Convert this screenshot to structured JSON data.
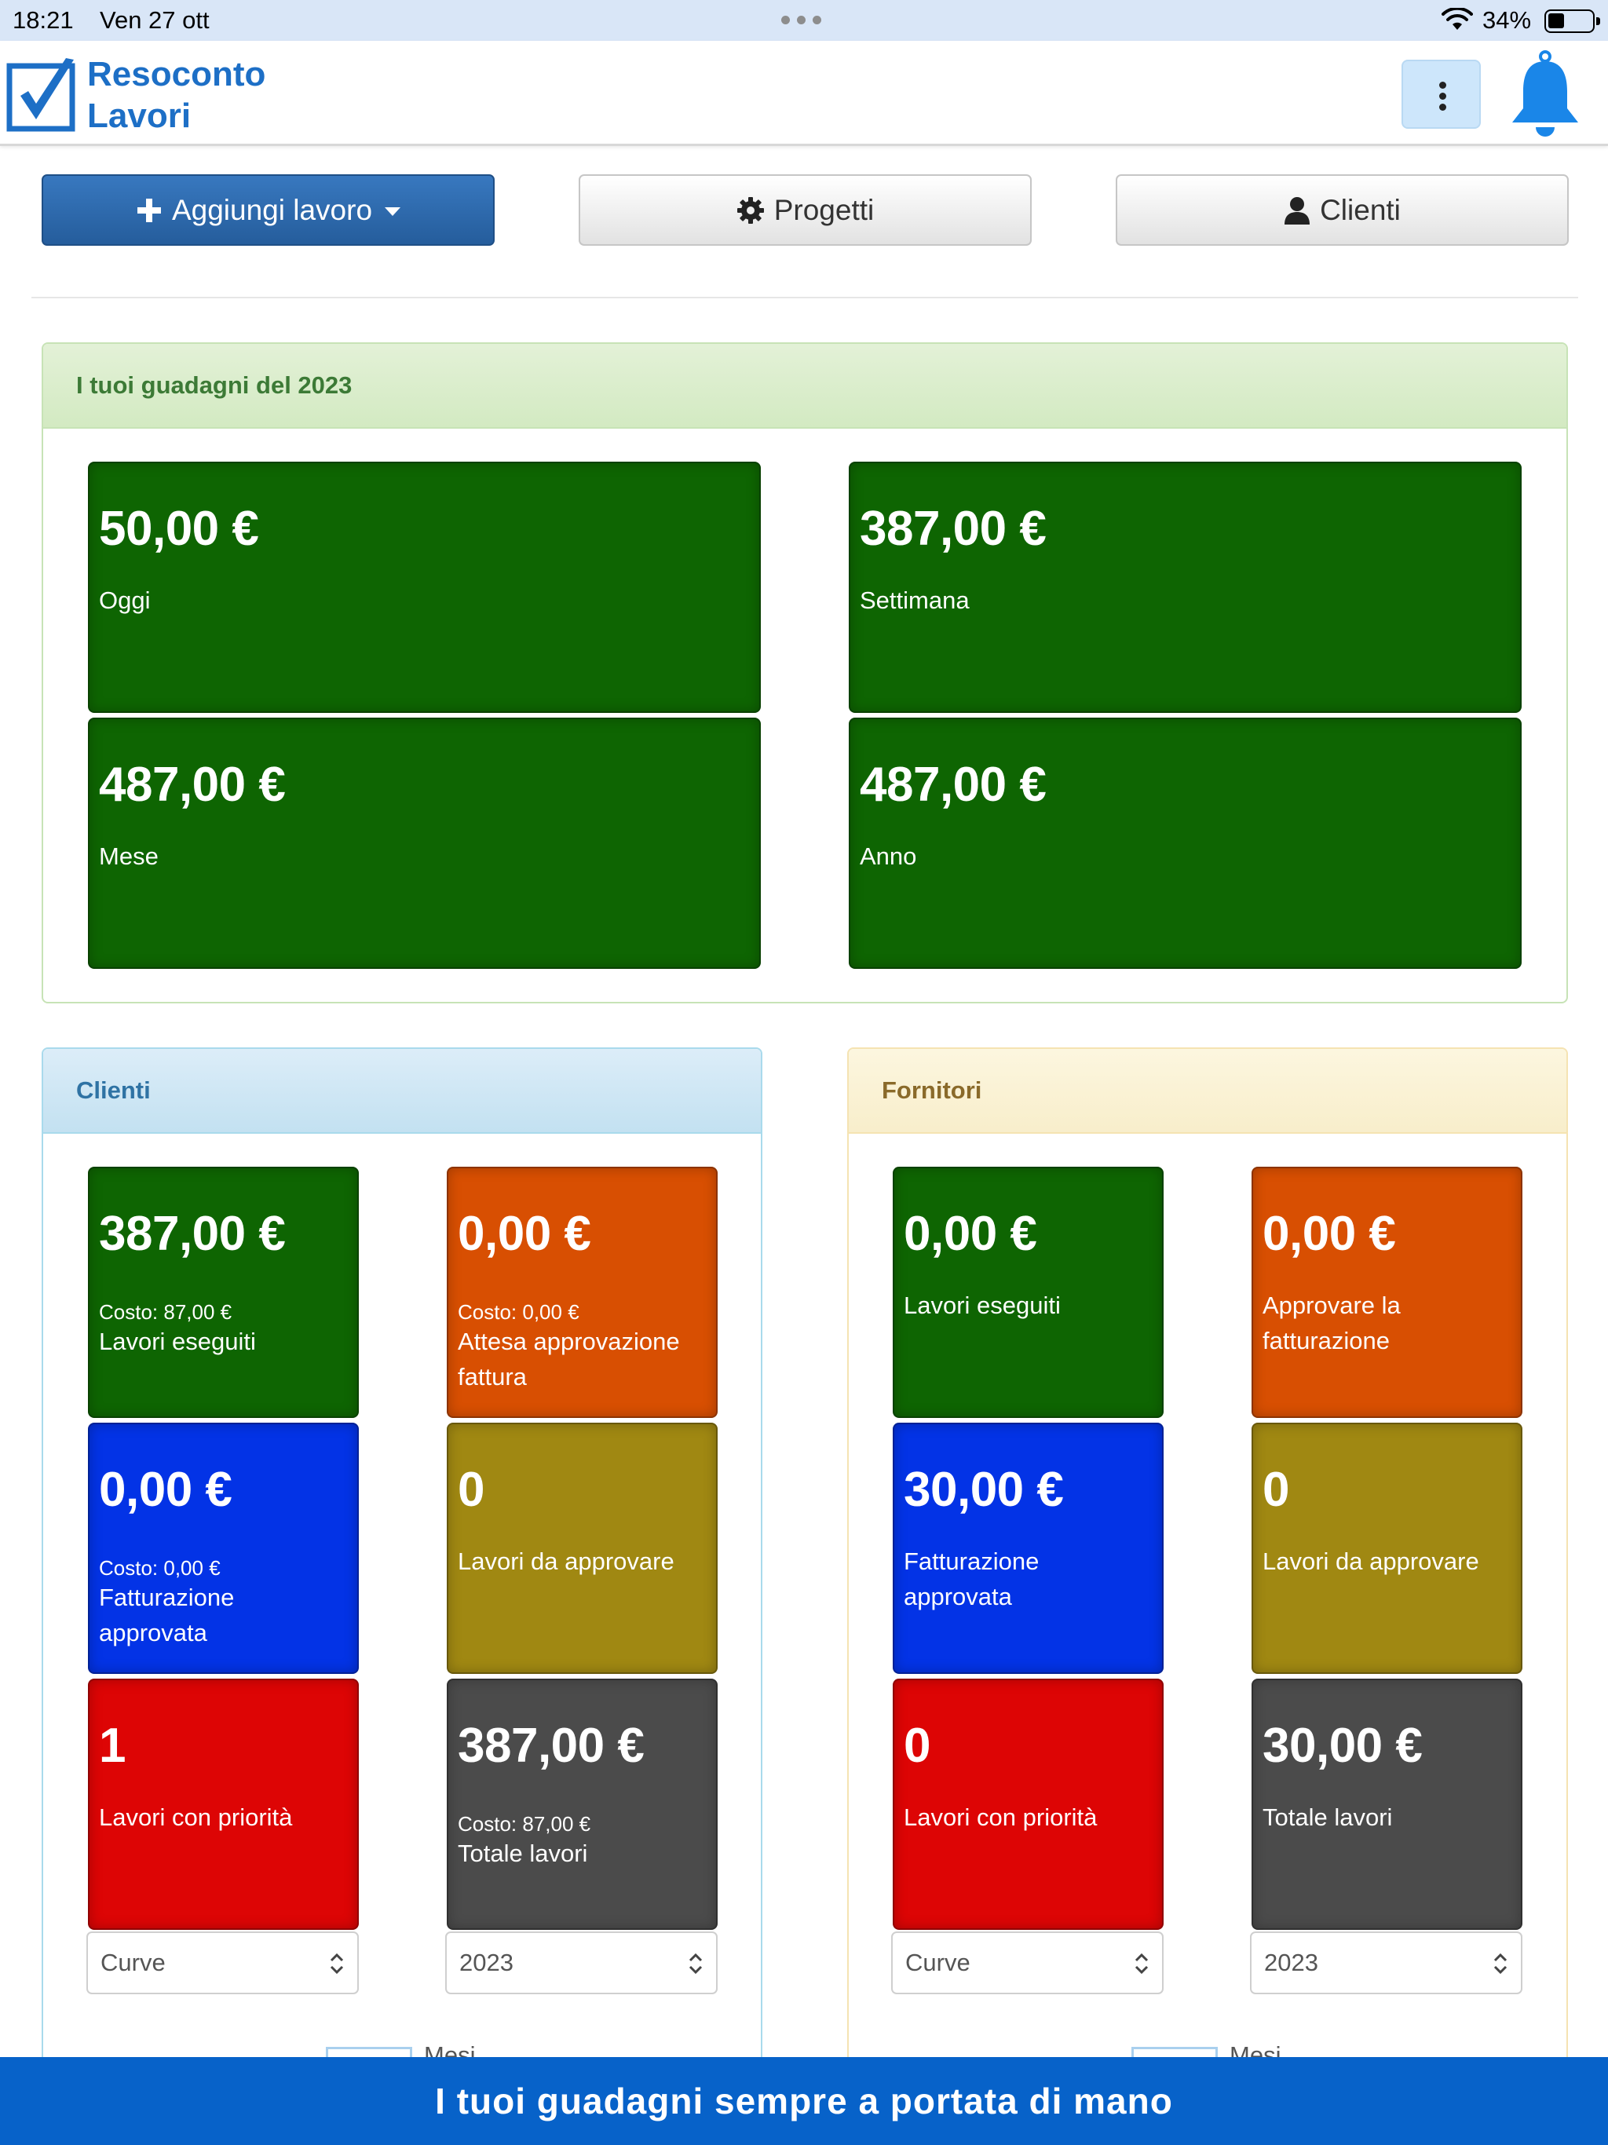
{
  "status_bar": {
    "time": "18:21",
    "date": "Ven 27 ott",
    "battery": "34%"
  },
  "app": {
    "logo_line1": "Resoconto",
    "logo_line2": "Lavori",
    "menu_icon": "vertical-dots-icon",
    "notification_icon": "bell-icon",
    "brand_color": "#1d6fc6"
  },
  "actions": {
    "add_job": "Aggiungi lavoro",
    "projects": "Progetti",
    "clients": "Clienti"
  },
  "earnings": {
    "title": "I tuoi guadagni del 2023",
    "tiles": [
      {
        "amount": "50,00 €",
        "label": "Oggi"
      },
      {
        "amount": "387,00 €",
        "label": "Settimana"
      },
      {
        "amount": "487,00 €",
        "label": "Mese"
      },
      {
        "amount": "487,00 €",
        "label": "Anno"
      }
    ]
  },
  "clients_panel": {
    "title": "Clienti",
    "tiles": [
      {
        "amount": "387,00 €",
        "cost": "Costo: 87,00 €",
        "label": "Lavori eseguiti",
        "color": "#0e6502"
      },
      {
        "amount": "0,00 €",
        "cost": "Costo: 0,00 €",
        "label": "Attesa approvazione fattura",
        "color": "#d84f02"
      },
      {
        "amount": "0,00 €",
        "cost": "Costo: 0,00 €",
        "label": "Fatturazione approvata",
        "color": "#0333e6"
      },
      {
        "amount": "0",
        "label": "Lavori da approvare",
        "color": "#a08812"
      },
      {
        "amount": "1",
        "label": "Lavori con priorità",
        "color": "#dd0505"
      },
      {
        "amount": "387,00 €",
        "cost": "Costo: 87,00 €",
        "label": "Totale lavori",
        "color": "#4b4b4b"
      }
    ],
    "chart_select": "Curve",
    "year_select": "2023",
    "partial_legend": "Mesi"
  },
  "suppliers_panel": {
    "title": "Fornitori",
    "tiles": [
      {
        "amount": "0,00 €",
        "label": "Lavori eseguiti",
        "color": "#0e6502"
      },
      {
        "amount": "0,00 €",
        "label": "Approvare la fatturazione",
        "color": "#d84f02"
      },
      {
        "amount": "30,00 €",
        "label": "Fatturazione approvata",
        "color": "#0333e6"
      },
      {
        "amount": "0",
        "label": "Lavori da approvare",
        "color": "#a08812"
      },
      {
        "amount": "0",
        "label": "Lavori con priorità",
        "color": "#dd0505"
      },
      {
        "amount": "30,00 €",
        "label": "Totale lavori",
        "color": "#4b4b4b"
      }
    ],
    "chart_select": "Curve",
    "year_select": "2023",
    "partial_legend": "Mesi"
  },
  "banner": "I tuoi guadagni sempre a portata di mano"
}
